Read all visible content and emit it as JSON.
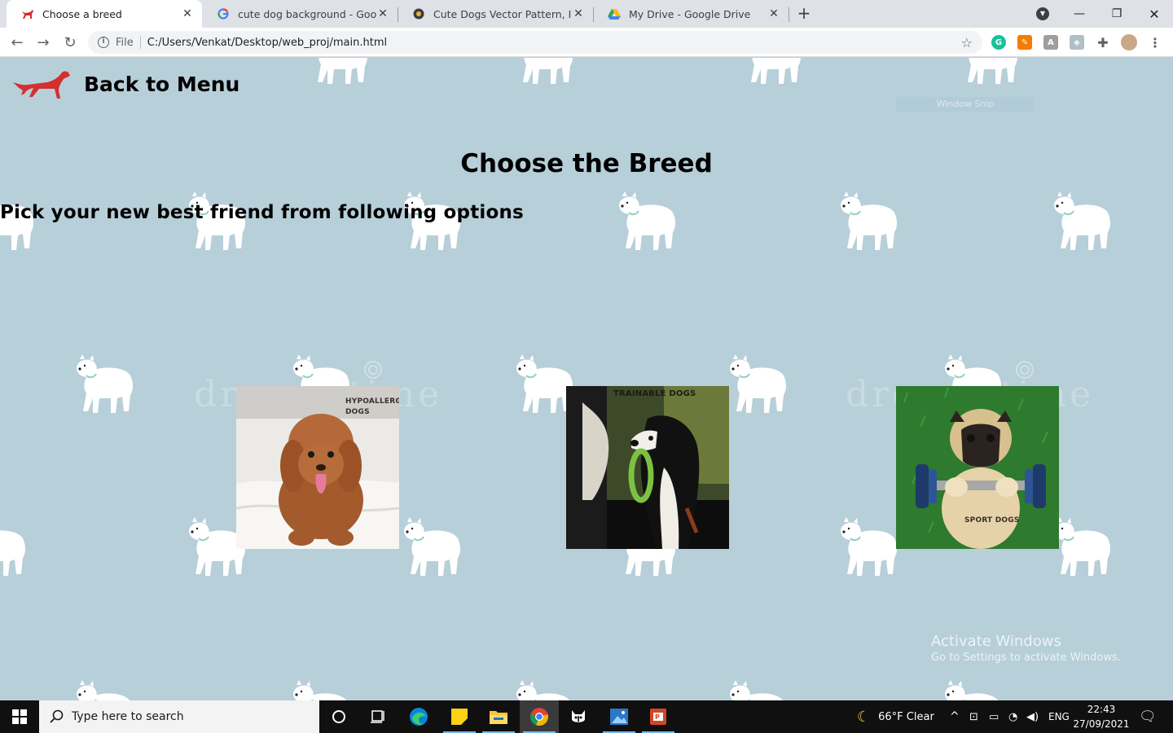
{
  "browser": {
    "tabs": [
      {
        "title": "Choose a breed",
        "active": true,
        "favicon": "red-dog-favicon"
      },
      {
        "title": "cute dog background - Google S",
        "active": false,
        "favicon": "google-g-icon"
      },
      {
        "title": "Cute Dogs Vector Pattern, Illustra",
        "active": false,
        "favicon": "vector-site-icon"
      },
      {
        "title": "My Drive - Google Drive",
        "active": false,
        "favicon": "google-drive-icon"
      }
    ],
    "address": {
      "scheme_label": "File",
      "url": "C:/Users/Venkat/Desktop/web_proj/main.html"
    }
  },
  "page": {
    "back_link": "Back to Menu",
    "title": "Choose the Breed",
    "subtitle": "Pick your new best friend from following options",
    "cards": [
      {
        "label_line1": "HYPOALLERGIC",
        "label_line2": "DOGS",
        "image": "fluffy-brown-poodle-on-bed"
      },
      {
        "label": "TRAINABLE DOGS",
        "image": "border-collie-with-ring-toy"
      },
      {
        "label": "SPORT DOGS",
        "image": "pug-lifting-dumbbell-on-grass"
      }
    ],
    "watermark_text": "dreamstime",
    "snip_overlay": "Window Snip",
    "activate_title": "Activate Windows",
    "activate_sub": "Go to Settings to activate Windows.",
    "background_color": "#b7cfd9"
  },
  "taskbar": {
    "search_placeholder": "Type here to search",
    "weather": "66°F  Clear",
    "language": "ENG",
    "time": "22:43",
    "date": "27/09/2021"
  }
}
